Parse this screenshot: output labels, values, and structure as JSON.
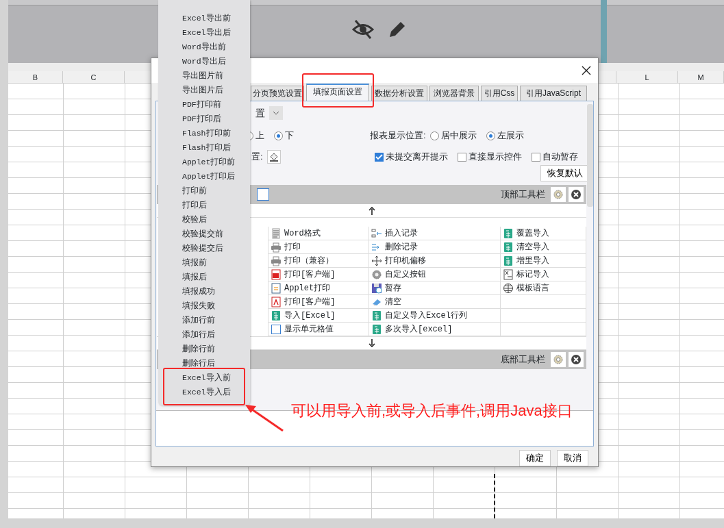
{
  "sheet": {
    "columns": [
      "B",
      "C",
      "L",
      "M"
    ]
  },
  "dialog": {
    "tabs": [
      {
        "label": "分页预览设置",
        "selected": false
      },
      {
        "label": "填报页面设置",
        "selected": true
      },
      {
        "label": "数据分析设置",
        "selected": false
      },
      {
        "label": "浏览器背景",
        "selected": false
      },
      {
        "label": "引用Css",
        "selected": false
      },
      {
        "label": "引用JavaScript",
        "selected": false
      }
    ],
    "layout_select": {
      "value": "置"
    },
    "toolbar_position": [
      {
        "label": "上",
        "selected": false
      },
      {
        "label": "下",
        "selected": true
      }
    ],
    "report_position": {
      "label": "报表显示位置:",
      "options": [
        {
          "label": "居中展示",
          "selected": false
        },
        {
          "label": "左展示",
          "selected": true
        }
      ]
    },
    "background": {
      "label": "置:"
    },
    "checkboxes": [
      {
        "label": "未提交离开提示",
        "checked": true
      },
      {
        "label": "直接显示控件",
        "checked": false
      },
      {
        "label": "自动暂存",
        "checked": false
      }
    ],
    "reset_button": "恢复默认",
    "top_toolbar": {
      "label": "顶部工具栏"
    },
    "button_rows": [
      [
        {
          "label": "Word格式",
          "kind": "word"
        },
        {
          "label": "插入记录",
          "kind": "insert"
        },
        {
          "label": "覆盖导入",
          "kind": "excel"
        }
      ],
      [
        {
          "label": "打印",
          "kind": "printer"
        },
        {
          "label": "删除记录",
          "kind": "delete"
        },
        {
          "label": "清空导入",
          "kind": "excel"
        }
      ],
      [
        {
          "label": "打印（兼容）",
          "kind": "printer"
        },
        {
          "label": "打印机偏移",
          "kind": "move"
        },
        {
          "label": "增里导入",
          "kind": "excel"
        }
      ],
      [
        {
          "label": "打印[客户端]",
          "kind": "flash"
        },
        {
          "label": "自定义按钮",
          "kind": "gear"
        },
        {
          "label": "标记导入",
          "kind": "mark"
        }
      ],
      [
        {
          "label": "Applet打印",
          "kind": "applet"
        },
        {
          "label": "暂存",
          "kind": "save"
        },
        {
          "label": "模板语言",
          "kind": "globe"
        }
      ],
      [
        {
          "label": "打印[客户端]",
          "kind": "pdf"
        },
        {
          "label": "清空",
          "kind": "eraser"
        }
      ],
      [
        {
          "label": "导入[Excel]",
          "kind": "excel"
        },
        {
          "label": "自定义导入Excel行列",
          "kind": "excel"
        }
      ],
      [
        {
          "label": "显示单元格值",
          "kind": "cell"
        },
        {
          "label": "多次导入[excel]",
          "kind": "excel"
        }
      ]
    ],
    "bottom_toolbar": {
      "label": "底部工具栏"
    },
    "footer_buttons": [
      "确定",
      "取消"
    ]
  },
  "menu": {
    "items": [
      {
        "label": "Excel导出前",
        "selected": false
      },
      {
        "label": "Excel导出后",
        "selected": false
      },
      {
        "label": "Word导出前",
        "selected": false
      },
      {
        "label": "Word导出后",
        "selected": false
      },
      {
        "label": "导出图片前",
        "selected": false
      },
      {
        "label": "导出图片后",
        "selected": false
      },
      {
        "label": "PDF打印前",
        "selected": false
      },
      {
        "label": "PDF打印后",
        "selected": false
      },
      {
        "label": "Flash打印前",
        "selected": false
      },
      {
        "label": "Flash打印后",
        "selected": false
      },
      {
        "label": "Applet打印前",
        "selected": false
      },
      {
        "label": "Applet打印后",
        "selected": false
      },
      {
        "label": "打印前",
        "selected": false
      },
      {
        "label": "打印后",
        "selected": false
      },
      {
        "label": "校验后",
        "selected": false
      },
      {
        "label": "校验提交前",
        "selected": false
      },
      {
        "label": "校验提交后",
        "selected": false
      },
      {
        "label": "填报前",
        "selected": false
      },
      {
        "label": "填报后",
        "selected": false
      },
      {
        "label": "填报成功",
        "selected": false
      },
      {
        "label": "填报失败",
        "selected": false
      },
      {
        "label": "添加行前",
        "selected": false
      },
      {
        "label": "添加行后",
        "selected": false
      },
      {
        "label": "删除行前",
        "selected": false
      },
      {
        "label": "删除行后",
        "selected": false
      },
      {
        "label": "Excel导入前",
        "selected": false
      },
      {
        "label": "Excel导入后",
        "selected": false
      }
    ]
  },
  "annotation": {
    "text": "可以用导入前,或导入后事件,调用Java接口"
  }
}
